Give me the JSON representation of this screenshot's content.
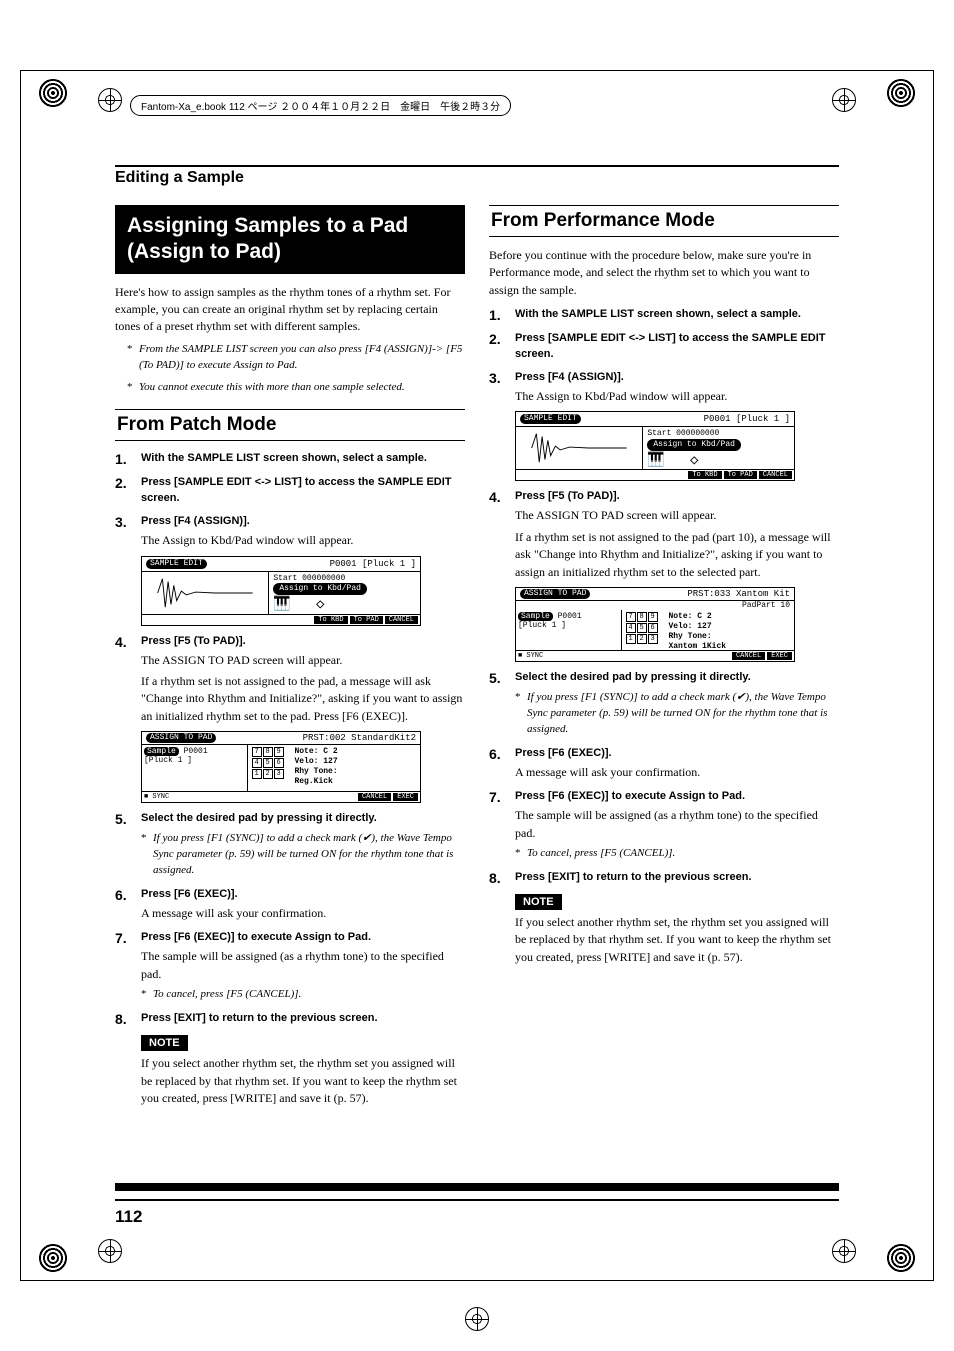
{
  "header_crop_text": "Fantom-Xa_e.book  112 ページ  ２００４年１０月２２日　金曜日　午後２時３分",
  "section_title": "Editing a Sample",
  "page_number": "112",
  "left": {
    "main_heading": "Assigning Samples to a Pad (Assign to Pad)",
    "intro": "Here's how to assign samples as the rhythm tones of a rhythm set. For example, you can create an original rhythm set by replacing certain tones of a preset rhythm set with different samples.",
    "note_a": "From the SAMPLE LIST screen you can also press [F4 (ASSIGN)]-> [F5 (To PAD)] to execute Assign to Pad.",
    "note_b": "You cannot execute this with more than one sample selected.",
    "sub_heading": "From Patch Mode",
    "steps": {
      "s1": "With the SAMPLE LIST screen shown, select a sample.",
      "s2": "Press [SAMPLE EDIT <-> LIST] to access the SAMPLE EDIT screen.",
      "s3": "Press [F4 (ASSIGN)].",
      "s3_body": "The Assign to Kbd/Pad window will appear.",
      "s4": "Press [F5 (To PAD)].",
      "s4_body_a": "The ASSIGN TO PAD screen will appear.",
      "s4_body_b": "If a rhythm set is not assigned to the pad, a message will ask \"Change into Rhythm and Initialize?\", asking if you want to assign an initialized rhythm set to the pad. Press [F6 (EXEC)].",
      "s5": "Select the desired pad by pressing it directly.",
      "s5_note": "If you press [F1 (SYNC)] to add a check mark (✔), the Wave Tempo Sync parameter (p. 59) will be turned ON for the rhythm tone that is assigned.",
      "s6": "Press [F6 (EXEC)].",
      "s6_body": "A message will ask your confirmation.",
      "s7": "Press [F6 (EXEC)] to execute Assign to Pad.",
      "s7_body": "The sample will be assigned (as a rhythm tone) to the specified pad.",
      "s7_note": "To cancel, press [F5 (CANCEL)].",
      "s8": "Press [EXIT] to return to the previous screen.",
      "note_label": "NOTE",
      "note_text": "If you select another rhythm set, the rhythm set you assigned will be replaced by that rhythm set. If you want to keep the rhythm set you created, press [WRITE] and save it (p. 57)."
    },
    "lcd1": {
      "tag": "SAMPLE EDIT",
      "header": "P0001 [Pluck 1           ]",
      "start": "Start      000000000",
      "banner": "Assign to Kbd/Pad",
      "btn1": "To KBD",
      "btn2": "To PAD",
      "btn3": "CANCEL"
    },
    "lcd2": {
      "tag": "ASSIGN TO PAD",
      "header": "PRST:002 StandardKit2",
      "sample_label": "Sample",
      "sample_id": "P0001",
      "sample_name": "[Pluck 1          ]",
      "note": "Note: C 2",
      "velo": "Velo:     127",
      "rhy": "Rhy Tone:",
      "rhy_name": "Reg.Kick",
      "sync": "■ SYNC",
      "btn1": "CANCEL",
      "btn2": "EXEC"
    }
  },
  "right": {
    "sub_heading": "From Performance Mode",
    "intro": "Before you continue with the procedure below, make sure you're in Performance mode, and select the rhythm set to which you want to assign the sample.",
    "steps": {
      "s1": "With the SAMPLE LIST screen shown, select a sample.",
      "s2": "Press [SAMPLE EDIT <-> LIST] to access the SAMPLE EDIT screen.",
      "s3": "Press [F4 (ASSIGN)].",
      "s3_body": "The Assign to Kbd/Pad window will appear.",
      "s4": "Press [F5 (To PAD)].",
      "s4_body_a": "The ASSIGN TO PAD screen will appear.",
      "s4_body_b": "If a rhythm set is not assigned to the pad (part 10), a message will ask \"Change into Rhythm and Initialize?\", asking if you want to assign an initialized rhythm set to the selected part.",
      "s5": "Select the desired pad by pressing it directly.",
      "s5_note": "If you press [F1 (SYNC)] to add a check mark (✔), the Wave Tempo Sync parameter (p. 59) will be turned ON for the rhythm tone that is assigned.",
      "s6": "Press [F6 (EXEC)].",
      "s6_body": "A message will ask your confirmation.",
      "s7": "Press [F6 (EXEC)] to execute Assign to Pad.",
      "s7_body": "The sample will be assigned (as a rhythm tone) to the specified pad.",
      "s7_note": "To cancel, press [F5 (CANCEL)].",
      "s8": "Press [EXIT] to return to the previous screen.",
      "note_label": "NOTE",
      "note_text": "If you select another rhythm set, the rhythm set you assigned will be replaced by that rhythm set. If you want to keep the rhythm set you created, press [WRITE] and save it (p. 57)."
    },
    "lcd1": {
      "tag": "SAMPLE EDIT",
      "header": "P0001 [Pluck 1           ]",
      "start": "Start      000000000",
      "banner": "Assign to Kbd/Pad",
      "btn1": "To KBD",
      "btn2": "To PAD",
      "btn3": "CANCEL"
    },
    "lcd2": {
      "tag": "ASSIGN TO PAD",
      "header": "PRST:033 Xantom Kit",
      "padpart": "PadPart 10",
      "sample_label": "Sample",
      "sample_id": "P0001",
      "sample_name": "[Pluck 1          ]",
      "note": "Note: C 2",
      "velo": "Velo:     127",
      "rhy": "Rhy Tone:",
      "rhy_name": "Xantom 1Kick",
      "sync": "■ SYNC",
      "btn1": "CANCEL",
      "btn2": "EXEC"
    }
  }
}
